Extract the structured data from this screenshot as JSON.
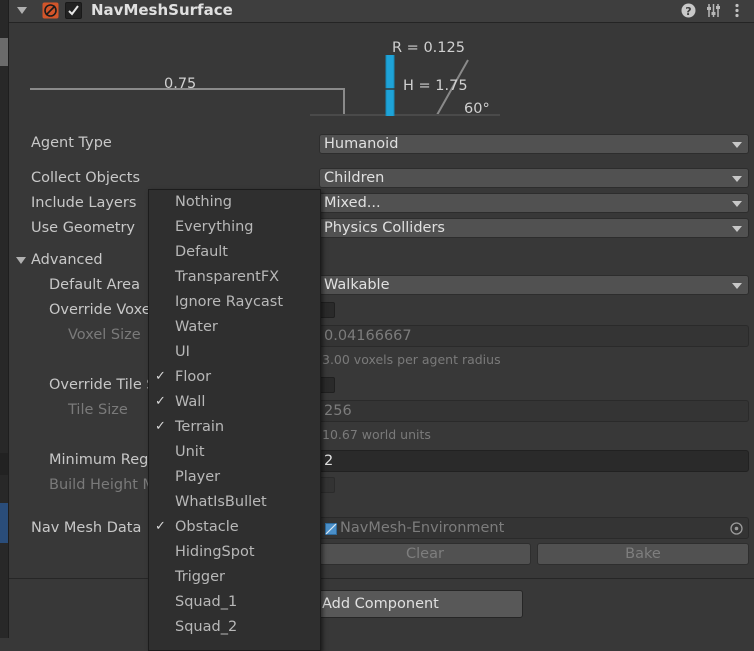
{
  "header": {
    "title": "NavMeshSurface",
    "icons": [
      "foldout-arrow-icon",
      "navmesh-component-icon",
      "enabled-checkbox",
      "help-icon",
      "presets-icon",
      "kebab-menu-icon"
    ]
  },
  "diagram": {
    "radius_label": "R = 0.125",
    "height_label": "H = 1.75",
    "step_label": "0.75",
    "slope_label": "60°"
  },
  "fields": {
    "agent_type": {
      "label": "Agent Type",
      "value": "Humanoid"
    },
    "collect_objects": {
      "label": "Collect Objects",
      "value": "Children"
    },
    "include_layers": {
      "label": "Include Layers",
      "value": "Mixed..."
    },
    "use_geometry": {
      "label": "Use Geometry",
      "value": "Physics Colliders"
    },
    "advanced": {
      "label": "Advanced"
    },
    "default_area": {
      "label": "Default Area",
      "value": "Walkable"
    },
    "override_voxel": {
      "label": "Override Voxe"
    },
    "voxel_size": {
      "label": "Voxel Size",
      "value": "0.04166667",
      "hint": "3.00 voxels per agent radius"
    },
    "override_tile": {
      "label": "Override Tile S"
    },
    "tile_size": {
      "label": "Tile Size",
      "value": "256",
      "hint": "10.67 world units"
    },
    "min_region": {
      "label": "Minimum Reg",
      "value": "2"
    },
    "build_height": {
      "label": "Build Height M"
    },
    "nav_mesh_data": {
      "label": "Nav Mesh Data",
      "value": "NavMesh-Environment"
    }
  },
  "buttons": {
    "clear": "Clear",
    "bake": "Bake",
    "add_component": "Add Component"
  },
  "layer_menu": {
    "items": [
      {
        "label": "Nothing",
        "checked": false
      },
      {
        "label": "Everything",
        "checked": false
      },
      {
        "label": "Default",
        "checked": false
      },
      {
        "label": "TransparentFX",
        "checked": false
      },
      {
        "label": "Ignore Raycast",
        "checked": false
      },
      {
        "label": "Water",
        "checked": false
      },
      {
        "label": "UI",
        "checked": false
      },
      {
        "label": "Floor",
        "checked": true
      },
      {
        "label": "Wall",
        "checked": true
      },
      {
        "label": "Terrain",
        "checked": true
      },
      {
        "label": "Unit",
        "checked": false
      },
      {
        "label": "Player",
        "checked": false
      },
      {
        "label": "WhatIsBullet",
        "checked": false
      },
      {
        "label": "Obstacle",
        "checked": true
      },
      {
        "label": "HidingSpot",
        "checked": false
      },
      {
        "label": "Trigger",
        "checked": false
      },
      {
        "label": "Squad_1",
        "checked": false
      },
      {
        "label": "Squad_2",
        "checked": false
      }
    ],
    "check_glyph": "✓"
  },
  "colors": {
    "agent_cylinder": "#1ea3d8",
    "menu_bg": "#2f2f2f",
    "inspector_bg": "#383838"
  }
}
